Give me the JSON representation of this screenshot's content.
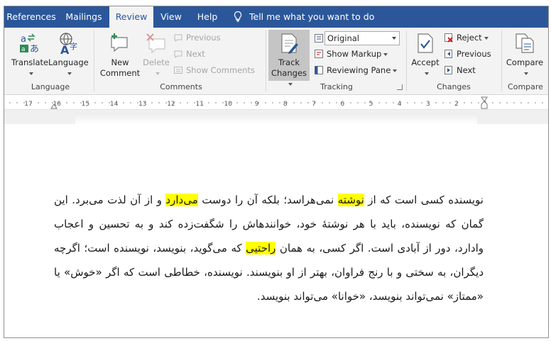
{
  "tabs": [
    "References",
    "Mailings",
    "Review",
    "View",
    "Help"
  ],
  "active_tab": "Review",
  "tell_me": "Tell me what you want to do",
  "ribbon": {
    "language_group": {
      "label": "Language",
      "translate": "Translate",
      "language": "Language"
    },
    "comments_group": {
      "label": "Comments",
      "new_comment_1": "New",
      "new_comment_2": "Comment",
      "delete": "Delete",
      "previous": "Previous",
      "next": "Next",
      "show_comments": "Show Comments"
    },
    "tracking_group": {
      "label": "Tracking",
      "track_changes_1": "Track",
      "track_changes_2": "Changes",
      "markup_value": "Original",
      "show_markup": "Show Markup",
      "reviewing_pane": "Reviewing Pane"
    },
    "changes_group": {
      "label": "Changes",
      "accept": "Accept",
      "reject": "Reject",
      "previous": "Previous",
      "next": "Next"
    },
    "compare_group": {
      "label": "Compare",
      "compare": "Compare"
    }
  },
  "ruler": {
    "numbers": [
      "17",
      "16",
      "15",
      "14",
      "13",
      "12",
      "11",
      "10",
      "9",
      "8",
      "7",
      "6",
      "5",
      "4",
      "3",
      "2",
      "1"
    ]
  },
  "document": {
    "segments": [
      {
        "text": "نویسنده کسی است که از ",
        "highlight": false
      },
      {
        "text": "نوشته",
        "highlight": true
      },
      {
        "text": " نمی‌هراسد؛ بلکه آن را دوست ",
        "highlight": false
      },
      {
        "text": "می‌دارد",
        "highlight": true
      },
      {
        "text": " و از آن لذت می‌برد. این گمان که نویسنده، باید با هر نوشتهٔ خود، خوانندهاش را شگفت‌زده کند و به تحسین و اعجاب وادارد، دور از آبادی است. اگر کسی، به همان ",
        "highlight": false
      },
      {
        "text": "راحتیی",
        "highlight": true
      },
      {
        "text": " که می‌گوید، بنویسد، نویسنده است؛ اگرچه دیگران، به سختی و با رنج فراوان، بهتر از او بنویسند. نویسنده، خطاطی است که اگر «خوش» یا «ممتاز» نمی‌تواند بنویسد، «خوانا» می‌تواند بنویسد.",
        "highlight": false
      }
    ]
  }
}
